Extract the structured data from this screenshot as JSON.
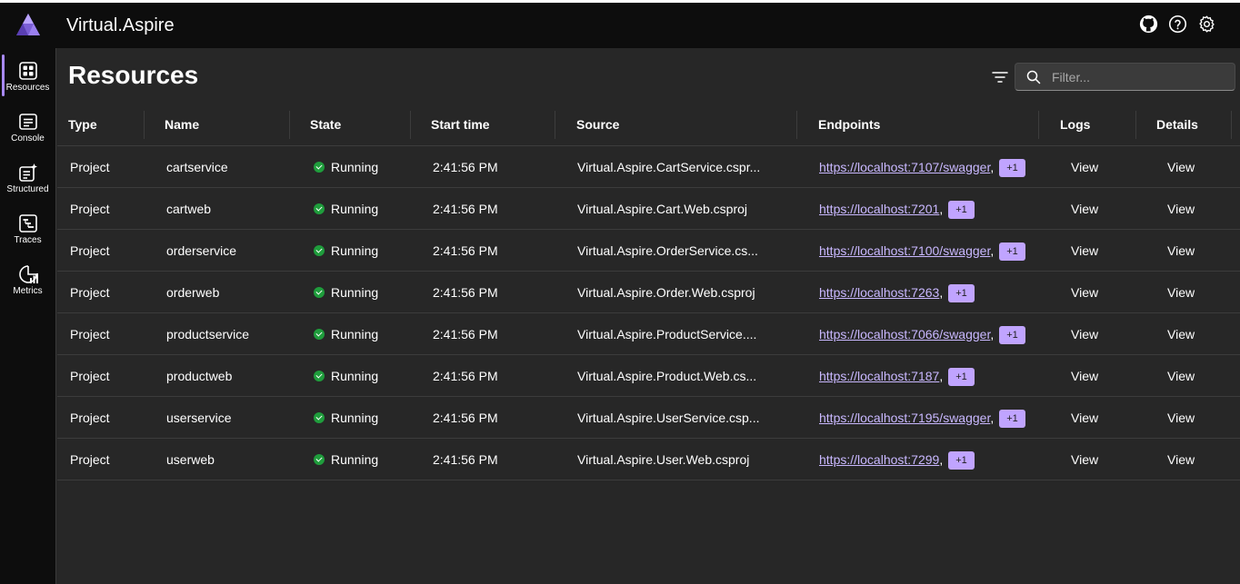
{
  "app": {
    "title": "Virtual.Aspire"
  },
  "header": {
    "icons": [
      "github-icon",
      "help-icon",
      "settings-icon"
    ]
  },
  "sidebar": {
    "items": [
      {
        "label": "Resources",
        "icon": "resources-icon",
        "active": true
      },
      {
        "label": "Console",
        "icon": "console-icon"
      },
      {
        "label": "Structured",
        "icon": "structured-logs-icon"
      },
      {
        "label": "Traces",
        "icon": "traces-icon"
      },
      {
        "label": "Metrics",
        "icon": "metrics-icon"
      }
    ]
  },
  "page": {
    "title": "Resources",
    "search_placeholder": "Filter..."
  },
  "table": {
    "columns": [
      "Type",
      "Name",
      "State",
      "Start time",
      "Source",
      "Endpoints",
      "Logs",
      "Details"
    ],
    "rows": [
      {
        "type": "Project",
        "name": "cartservice",
        "state": "Running",
        "start": "2:41:56 PM",
        "source": "Virtual.Aspire.CartService.cspr...",
        "endpoint": "https://localhost:7107/swagger",
        "badge": "+1",
        "logs": "View",
        "details": "View"
      },
      {
        "type": "Project",
        "name": "cartweb",
        "state": "Running",
        "start": "2:41:56 PM",
        "source": "Virtual.Aspire.Cart.Web.csproj",
        "endpoint": "https://localhost:7201",
        "badge": "+1",
        "logs": "View",
        "details": "View"
      },
      {
        "type": "Project",
        "name": "orderservice",
        "state": "Running",
        "start": "2:41:56 PM",
        "source": "Virtual.Aspire.OrderService.cs...",
        "endpoint": "https://localhost:7100/swagger",
        "badge": "+1",
        "logs": "View",
        "details": "View"
      },
      {
        "type": "Project",
        "name": "orderweb",
        "state": "Running",
        "start": "2:41:56 PM",
        "source": "Virtual.Aspire.Order.Web.csproj",
        "endpoint": "https://localhost:7263",
        "badge": "+1",
        "logs": "View",
        "details": "View"
      },
      {
        "type": "Project",
        "name": "productservice",
        "state": "Running",
        "start": "2:41:56 PM",
        "source": "Virtual.Aspire.ProductService....",
        "endpoint": "https://localhost:7066/swagger",
        "badge": "+1",
        "logs": "View",
        "details": "View"
      },
      {
        "type": "Project",
        "name": "productweb",
        "state": "Running",
        "start": "2:41:56 PM",
        "source": "Virtual.Aspire.Product.Web.cs...",
        "endpoint": "https://localhost:7187",
        "badge": "+1",
        "logs": "View",
        "details": "View"
      },
      {
        "type": "Project",
        "name": "userservice",
        "state": "Running",
        "start": "2:41:56 PM",
        "source": "Virtual.Aspire.UserService.csp...",
        "endpoint": "https://localhost:7195/swagger",
        "badge": "+1",
        "logs": "View",
        "details": "View"
      },
      {
        "type": "Project",
        "name": "userweb",
        "state": "Running",
        "start": "2:41:56 PM",
        "source": "Virtual.Aspire.User.Web.csproj",
        "endpoint": "https://localhost:7299",
        "badge": "+1",
        "logs": "View",
        "details": "View"
      }
    ]
  },
  "colors": {
    "accent": "#c9b8ff",
    "badge": "#c0a4ff",
    "running": "#1f9d3c",
    "background": "#272727",
    "chrome": "#0d0d0d"
  }
}
